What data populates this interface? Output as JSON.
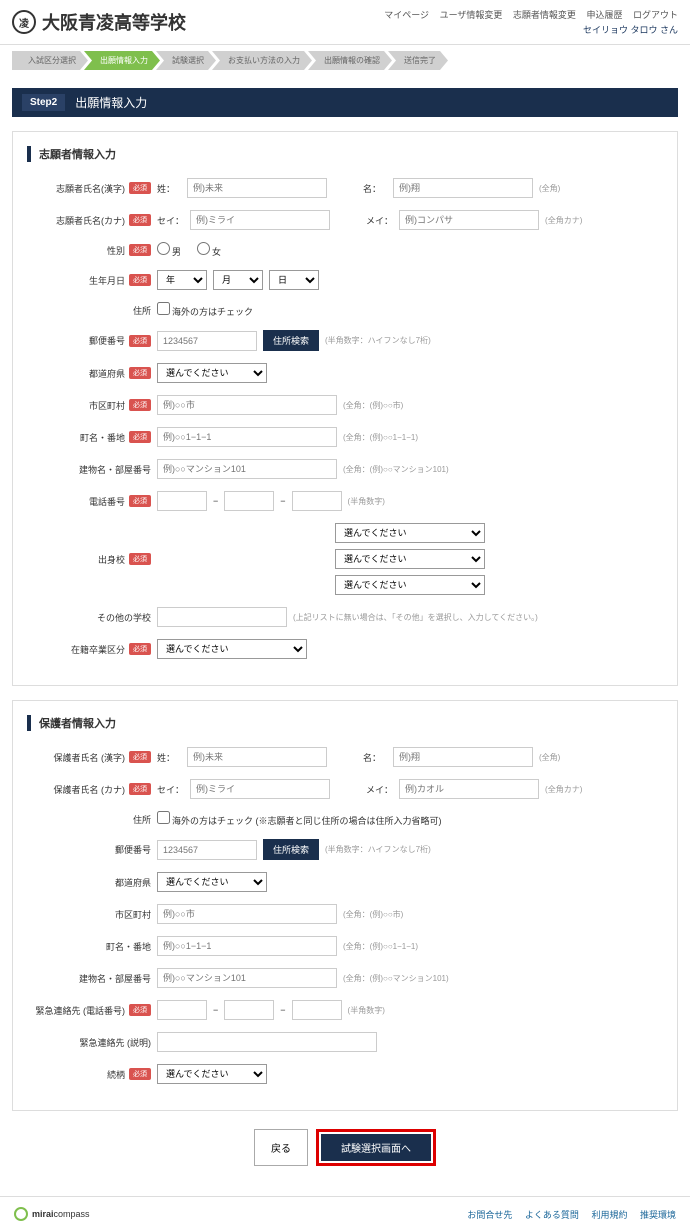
{
  "header": {
    "school_name": "大阪青凌高等学校",
    "nav": {
      "mypage": "マイページ",
      "user_edit": "ユーザ情報変更",
      "applicant_edit": "志願者情報変更",
      "history": "申込履歴",
      "logout": "ログアウト"
    },
    "user_prefix": "セイリョウ タロウ さん"
  },
  "steps": {
    "s1": "入試区分選択",
    "s2": "出願情報入力",
    "s3": "試験選択",
    "s4": "お支払い方法の入力",
    "s5": "出願情報の確認",
    "s6": "送信完了"
  },
  "stepheader": {
    "label": "Step2",
    "title": "出願情報入力"
  },
  "applicant": {
    "panel_title": "志願者情報入力",
    "name_kanji_label": "志願者氏名(漢字)",
    "sei_label": "姓：",
    "mei_label": "名：",
    "sei_ph": "例)未来",
    "mei_ph": "例)翔",
    "name_hint": "(全角)",
    "name_kana_label": "志願者氏名(カナ)",
    "sei_kana_label": "セイ：",
    "mei_kana_label": "メイ：",
    "sei_kana_ph": "例)ミライ",
    "mei_kana_ph": "例)コンパサ",
    "kana_hint": "(全角カナ)",
    "gender_label": "性別",
    "male": "男",
    "female": "女",
    "birth_label": "生年月日",
    "year": "年",
    "month": "月",
    "day": "日",
    "addr_label": "住所",
    "overseas": "海外の方はチェック",
    "zip_label": "郵便番号",
    "zip_ph": "1234567",
    "zip_btn": "住所検索",
    "zip_hint": "(半角数字：ハイフンなし7桁)",
    "pref_label": "都道府県",
    "select_ph": "選んでください",
    "city_label": "市区町村",
    "city_ph": "例)○○市",
    "city_hint": "(全角：(例)○○市)",
    "town_label": "町名・番地",
    "town_ph": "例)○○1−1−1",
    "town_hint": "(全角：(例)○○1−1−1)",
    "building_label": "建物名・部屋番号",
    "building_ph": "例)○○マンション101",
    "building_hint": "(全角：(例)○○マンション101)",
    "tel_label": "電話番号",
    "tel_hint": "(半角数字)",
    "school_label": "出身校",
    "other_school_label": "その他の学校",
    "other_school_hint": "(上記リストに無い場合は、「その他」を選択し、入力してください。)",
    "enrollment_label": "在籍卒業区分"
  },
  "guardian": {
    "panel_title": "保護者情報入力",
    "name_kanji_label": "保護者氏名 (漢字)",
    "sei_label": "姓：",
    "mei_label": "名：",
    "sei_ph": "例)未来",
    "mei_ph": "例)翔",
    "name_hint": "(全角)",
    "name_kana_label": "保護者氏名 (カナ)",
    "sei_kana_label": "セイ：",
    "mei_kana_label": "メイ：",
    "sei_kana_ph": "例)ミライ",
    "mei_kana_ph": "例)カオル",
    "kana_hint": "(全角カナ)",
    "addr_label": "住所",
    "overseas": "海外の方はチェック (※志願者と同じ住所の場合は住所入力省略可)",
    "zip_label": "郵便番号",
    "zip_ph": "1234567",
    "zip_btn": "住所検索",
    "zip_hint": "(半角数字：ハイフンなし7桁)",
    "pref_label": "都道府県",
    "select_ph": "選んでください",
    "city_label": "市区町村",
    "city_ph": "例)○○市",
    "city_hint": "(全角：(例)○○市)",
    "town_label": "町名・番地",
    "town_ph": "例)○○1−1−1",
    "town_hint": "(全角：(例)○○1−1−1)",
    "building_label": "建物名・部屋番号",
    "building_ph": "例)○○マンション101",
    "building_hint": "(全角：(例)○○マンション101)",
    "tel_label": "緊急連絡先 (電話番号)",
    "tel_hint": "(半角数字)",
    "desc_label": "緊急連絡先 (説明)",
    "relation_label": "続柄",
    "select_ph2": "選んでください"
  },
  "buttons": {
    "back": "戻る",
    "next": "試験選択画面へ"
  },
  "footer": {
    "brand_bold": "mirai",
    "brand_rest": "compass",
    "contact": "お問合せ先",
    "faq": "よくある質問",
    "terms": "利用規約",
    "env": "推奨環境"
  },
  "required": "必須"
}
